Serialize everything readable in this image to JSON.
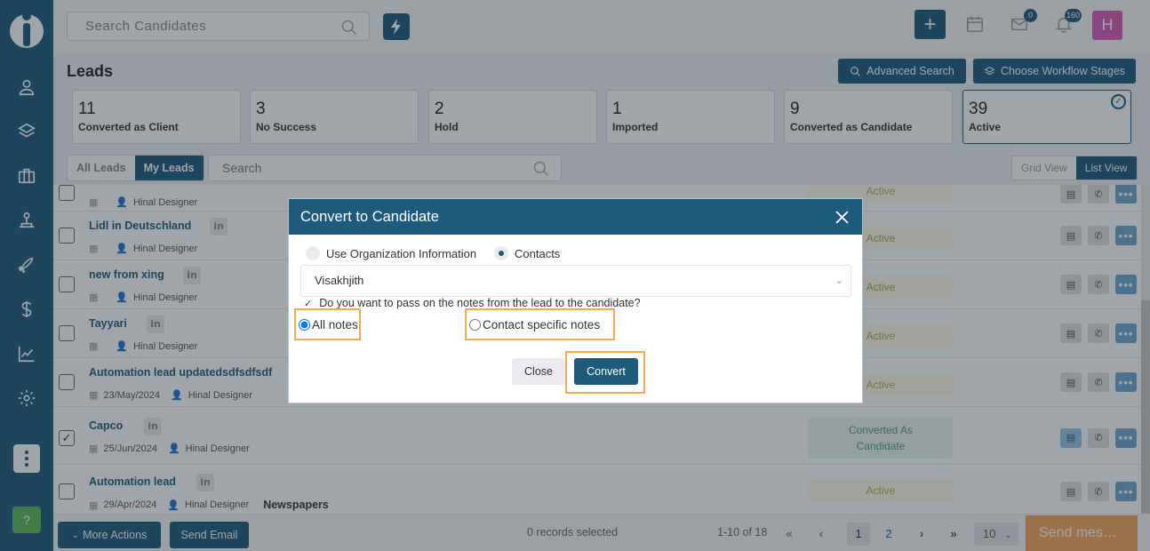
{
  "topbar": {
    "search_placeholder": "Search Candidates",
    "notifications": {
      "messages_count": "0",
      "bell_count": "160"
    },
    "avatar_letter": "H",
    "plus_label": "+"
  },
  "page": {
    "title": "Leads",
    "advanced_search": "Advanced Search",
    "workflow_stages": "Choose Workflow Stages"
  },
  "stats": [
    {
      "num": "11",
      "label": "Converted as Client"
    },
    {
      "num": "3",
      "label": "No Success"
    },
    {
      "num": "2",
      "label": "Hold"
    },
    {
      "num": "1",
      "label": "Imported"
    },
    {
      "num": "9",
      "label": "Converted as Candidate"
    },
    {
      "num": "39",
      "label": "Active"
    }
  ],
  "filters": {
    "all_leads": "All Leads",
    "my_leads": "My Leads",
    "search_placeholder": "Search",
    "grid_view": "Grid View",
    "list_view": "List View"
  },
  "rows": [
    {
      "name": "",
      "owner": "Hinal Designer",
      "date": "",
      "status": "Active",
      "source": ""
    },
    {
      "name": "Lidl in Deutschland",
      "owner": "Hinal Designer",
      "date": "",
      "status": "Active",
      "source": ""
    },
    {
      "name": "new from xing",
      "owner": "Hinal Designer",
      "date": "",
      "status": "Active",
      "source": ""
    },
    {
      "name": "Tayyari",
      "owner": "Hinal Designer",
      "date": "",
      "status": "Active",
      "source": ""
    },
    {
      "name": "Automation lead updatedsdfsdfsdf",
      "owner": "Hinal Designer",
      "date": "23/May/2024",
      "status": "Active",
      "source": ""
    },
    {
      "name": "Capco",
      "owner": "Hinal Designer",
      "date": "25/Jun/2024",
      "status": "Converted As Candidate",
      "source": ""
    },
    {
      "name": "Automation lead",
      "owner": "Hinal Designer",
      "date": "29/Apr/2024",
      "status": "Active",
      "source": "Newspapers"
    }
  ],
  "footer": {
    "more_actions": "More Actions",
    "send_email": "Send Email",
    "records_selected": "0 records selected",
    "range": "1-10 of 18",
    "pages": [
      "1",
      "2"
    ],
    "per_page": "10",
    "send_message": "Send mes…"
  },
  "modal": {
    "title": "Convert to Candidate",
    "opt_org": "Use Organization Information",
    "opt_contacts": "Contacts",
    "selected_contact": "Visakhjith",
    "notes_question": "Do you want to pass on the notes from the lead to the candidate?",
    "all_notes": "All notes",
    "contact_notes": "Contact specific notes",
    "close": "Close",
    "convert": "Convert"
  },
  "colors": {
    "brand": "#1d5a7c",
    "highlight": "#f5a75a",
    "avatar": "#d95bb8",
    "help": "#5fb85a"
  },
  "icons": [
    "user-icon",
    "layers-icon",
    "briefcase-icon",
    "org-icon",
    "rocket-icon",
    "dollar-icon",
    "chart-icon",
    "gear-icon",
    "calendar-icon",
    "mail-icon",
    "bell-icon",
    "search-icon",
    "bolt-icon",
    "linkedin-icon",
    "document-icon",
    "phone-icon"
  ]
}
